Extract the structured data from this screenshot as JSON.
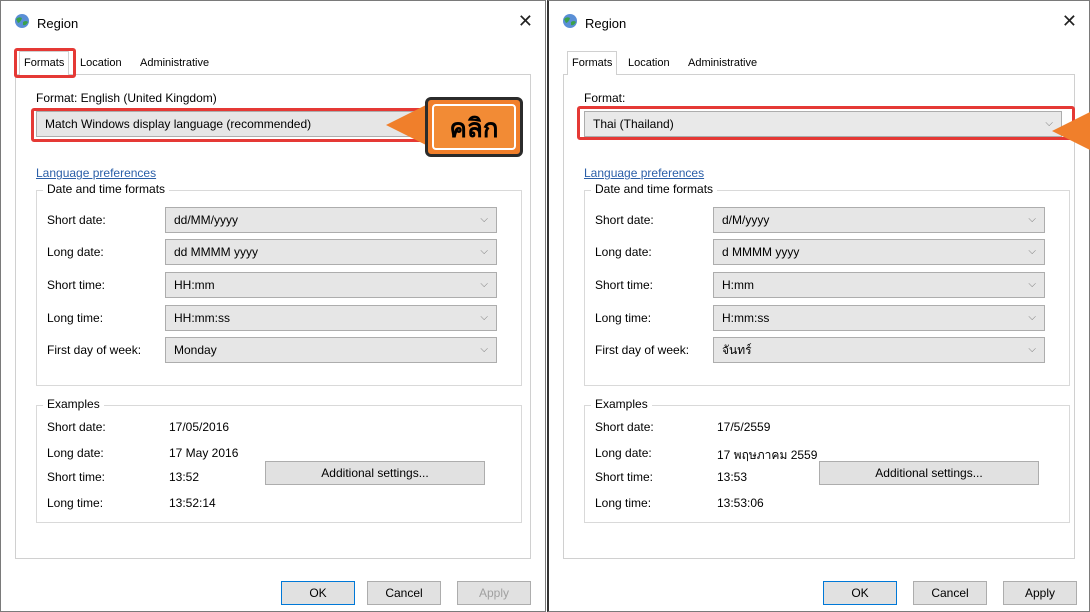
{
  "colors": {
    "highlight": "#e53935",
    "callout": "#f17f2b",
    "link": "#2b5fa8"
  },
  "left": {
    "title": "Region",
    "close_glyph": "✕",
    "tabs": [
      "Formats",
      "Location",
      "Administrative"
    ],
    "format_label": "Format: English (United Kingdom)",
    "format_value": "Match Windows display language (recommended)",
    "language_link": "Language preferences",
    "dt_group_title": "Date and time formats",
    "rows": [
      {
        "label": "Short date:",
        "value": "dd/MM/yyyy"
      },
      {
        "label": "Long date:",
        "value": "dd MMMM yyyy"
      },
      {
        "label": "Short time:",
        "value": "HH:mm"
      },
      {
        "label": "Long time:",
        "value": "HH:mm:ss"
      },
      {
        "label": "First day of week:",
        "value": "Monday"
      }
    ],
    "examples_title": "Examples",
    "examples": [
      {
        "label": "Short date:",
        "value": "17/05/2016"
      },
      {
        "label": "Long date:",
        "value": "17 May 2016"
      },
      {
        "label": "Short time:",
        "value": "13:52"
      },
      {
        "label": "Long time:",
        "value": "13:52:14"
      }
    ],
    "additional_settings": "Additional settings...",
    "ok": "OK",
    "cancel": "Cancel",
    "apply": "Apply",
    "callout_text": "คลิก"
  },
  "right": {
    "title": "Region",
    "close_glyph": "✕",
    "tabs": [
      "Formats",
      "Location",
      "Administrative"
    ],
    "format_label": "Format:",
    "format_value": "Thai (Thailand)",
    "language_link": "Language preferences",
    "dt_group_title": "Date and time formats",
    "rows": [
      {
        "label": "Short date:",
        "value": "d/M/yyyy"
      },
      {
        "label": "Long date:",
        "value": "d MMMM yyyy"
      },
      {
        "label": "Short time:",
        "value": "H:mm"
      },
      {
        "label": "Long time:",
        "value": "H:mm:ss"
      },
      {
        "label": "First day of week:",
        "value": "จันทร์"
      }
    ],
    "examples_title": "Examples",
    "examples": [
      {
        "label": "Short date:",
        "value": "17/5/2559"
      },
      {
        "label": "Long date:",
        "value": "17 พฤษภาคม 2559"
      },
      {
        "label": "Short time:",
        "value": "13:53"
      },
      {
        "label": "Long time:",
        "value": "13:53:06"
      }
    ],
    "additional_settings": "Additional settings...",
    "ok": "OK",
    "cancel": "Cancel",
    "apply": "Apply"
  }
}
